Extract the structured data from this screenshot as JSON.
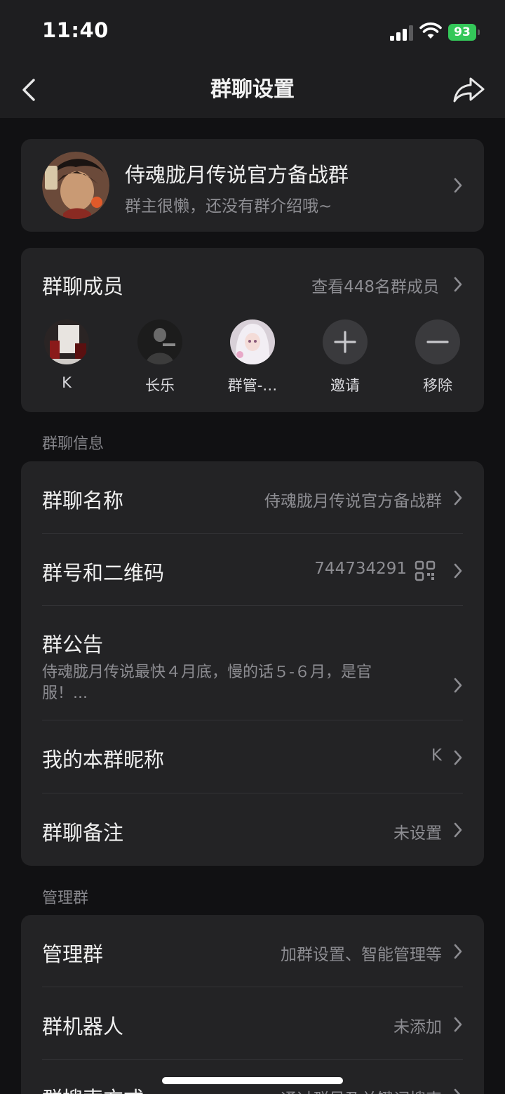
{
  "status_bar": {
    "time": "11:40",
    "battery": "93"
  },
  "nav": {
    "title": "群聊设置"
  },
  "group": {
    "name": "侍魂胧月传说官方备战群",
    "intro": "群主很懒，还没有群介绍哦~"
  },
  "members": {
    "title": "群聊成员",
    "view_all": "查看448名群成员",
    "list": [
      {
        "name": "K"
      },
      {
        "name": "长乐"
      },
      {
        "name": "群管-…"
      }
    ],
    "invite_label": "邀请",
    "remove_label": "移除"
  },
  "info": {
    "section_label": "群聊信息",
    "group_name_label": "群聊名称",
    "group_name_value": "侍魂胧月传说官方备战群",
    "group_id_label": "群号和二维码",
    "group_id_value": "744734291",
    "notice_label": "群公告",
    "notice_text": "侍魂胧月传说最快４月底，慢的话５-６月，是官服！...",
    "nickname_label": "我的本群昵称",
    "nickname_value": "K",
    "remark_label": "群聊备注",
    "remark_value": "未设置"
  },
  "manage": {
    "section_label": "管理群",
    "manage_label": "管理群",
    "manage_value": "加群设置、智能管理等",
    "bot_label": "群机器人",
    "bot_value": "未添加",
    "search_label": "群搜索方式",
    "search_value": "通过群号及关键词搜索"
  },
  "colors": {
    "background": "#111113",
    "header": "#1e1e20",
    "card": "#232325",
    "battery": "#34c759",
    "secondary_text": "#8d8d92"
  }
}
